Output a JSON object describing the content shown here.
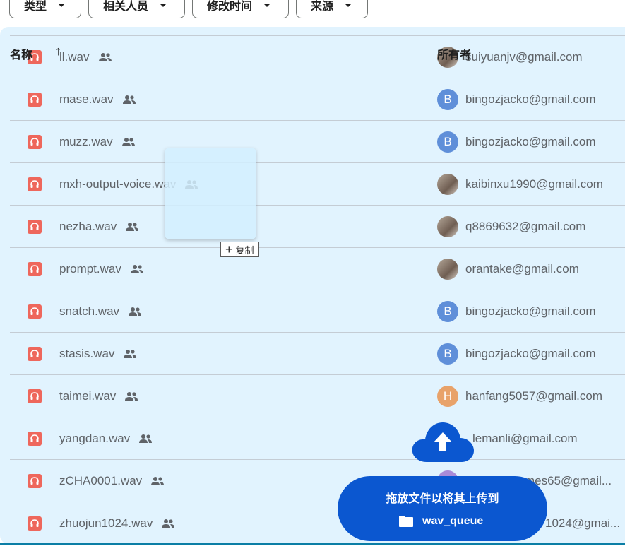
{
  "filters": [
    "类型",
    "相关人员",
    "修改时间",
    "来源"
  ],
  "table": {
    "col_name": "名称",
    "col_owner": "所有者",
    "sort_glyph": "↑",
    "rows": [
      {
        "name": "ll.wav",
        "owner": "suiyuanjv@gmail.com",
        "avatar": "",
        "avatar_color": "photo"
      },
      {
        "name": "mase.wav",
        "owner": "bingozjacko@gmail.com",
        "avatar": "B",
        "avatar_color": "#5f8fd9"
      },
      {
        "name": "muzz.wav",
        "owner": "bingozjacko@gmail.com",
        "avatar": "B",
        "avatar_color": "#5f8fd9"
      },
      {
        "name": "mxh-output-voice.wav",
        "owner": "kaibinxu1990@gmail.com",
        "avatar": "",
        "avatar_color": "photo"
      },
      {
        "name": "nezha.wav",
        "owner": "q8869632@gmail.com",
        "avatar": "",
        "avatar_color": "photo"
      },
      {
        "name": "prompt.wav",
        "owner": "orantake@gmail.com",
        "avatar": "",
        "avatar_color": "photo"
      },
      {
        "name": "snatch.wav",
        "owner": "bingozjacko@gmail.com",
        "avatar": "B",
        "avatar_color": "#5f8fd9"
      },
      {
        "name": "stasis.wav",
        "owner": "bingozjacko@gmail.com",
        "avatar": "B",
        "avatar_color": "#5f8fd9"
      },
      {
        "name": "taimei.wav",
        "owner": "hanfang5057@gmail.com",
        "avatar": "H",
        "avatar_color": "#e8a26a"
      },
      {
        "name": "yangdan.wav",
        "owner": "lemanli@gmail.com",
        "avatar": "",
        "avatar_color": "#e1f3fe"
      },
      {
        "name": "zCHA0001.wav",
        "owner": "mes65@gmail...",
        "avatar": "",
        "avatar_color": "#a98bd8"
      },
      {
        "name": "zhuojun1024.wav",
        "owner": "1024@gmai...",
        "avatar": "",
        "avatar_color": "#e1f3fe"
      }
    ]
  },
  "drag": {
    "copy_label": "复制"
  },
  "upload": {
    "title": "拖放文件以将其上传到",
    "folder": "wav_queue"
  },
  "colors": {
    "accent": "#0b57d0",
    "panel": "#e1f3fe",
    "audio_icon": "#ee675c"
  }
}
